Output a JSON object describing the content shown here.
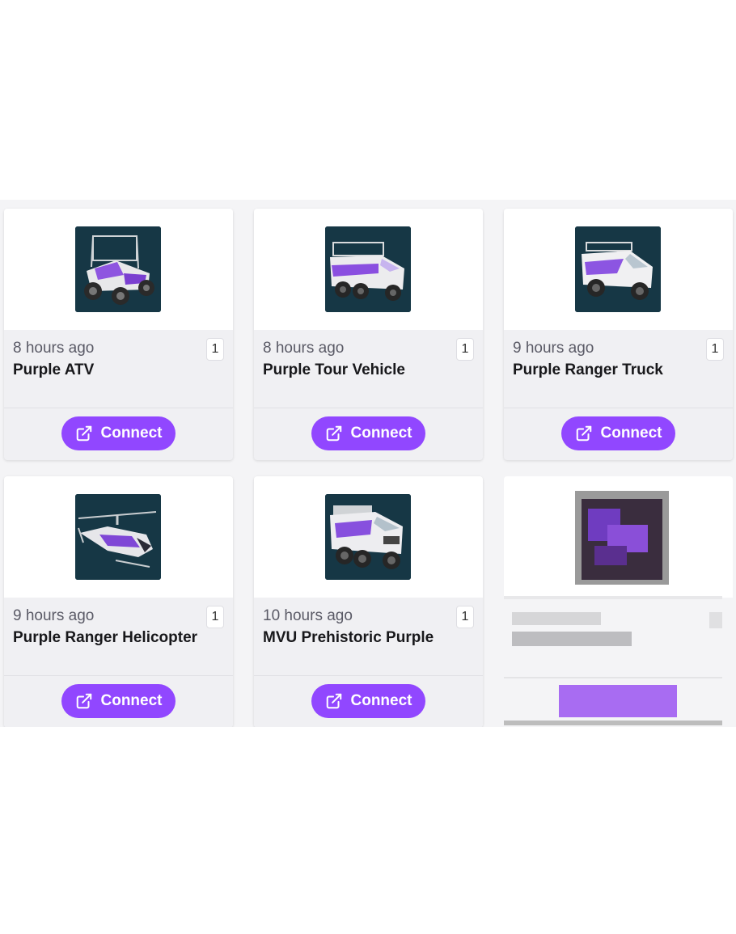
{
  "cards": [
    {
      "time": "8 hours ago",
      "title": "Purple ATV",
      "count": "1",
      "button": "Connect",
      "icon": "atv-thumbnail"
    },
    {
      "time": "8 hours ago",
      "title": "Purple Tour Vehicle",
      "count": "1",
      "button": "Connect",
      "icon": "tour-vehicle-thumbnail"
    },
    {
      "time": "9 hours ago",
      "title": "Purple Ranger Truck",
      "count": "1",
      "button": "Connect",
      "icon": "ranger-truck-thumbnail"
    },
    {
      "time": "9 hours ago",
      "title": "Purple Ranger Helicopter",
      "count": "1",
      "button": "Connect",
      "icon": "helicopter-thumbnail"
    },
    {
      "time": "10 hours ago",
      "title": "MVU Prehistoric Purple",
      "count": "1",
      "button": "Connect",
      "icon": "mvu-thumbnail"
    }
  ],
  "colors": {
    "accent": "#9147ff",
    "thumb_bg": "#163745",
    "card_bg": "#f0f0f3"
  },
  "connect_icon": "external-link-icon"
}
